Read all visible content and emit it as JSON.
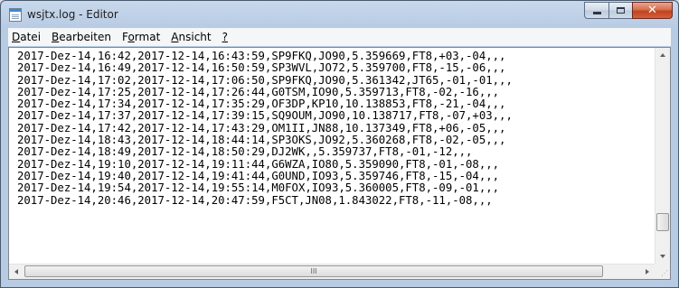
{
  "window": {
    "title": "wsjtx.log - Editor",
    "buttons": {
      "minimize": "–",
      "maximize": "□",
      "close": "✕"
    }
  },
  "menu": [
    {
      "label": "Datei",
      "mnemonic": "D",
      "rest": "atei"
    },
    {
      "label": "Bearbeiten",
      "mnemonic": "B",
      "rest": "earbeiten"
    },
    {
      "label": "Format",
      "pre": "F",
      "mnemonic": "o",
      "rest": "rmat"
    },
    {
      "label": "Ansicht",
      "mnemonic": "A",
      "rest": "nsicht"
    },
    {
      "label": "?",
      "mnemonic": "?",
      "rest": ""
    }
  ],
  "editor": {
    "lines": [
      "2017-Dez-14,16:42,2017-12-14,16:43:59,SP9FKQ,JO90,5.359669,FT8,+03,-04,,,",
      "2017-Dez-14,16:49,2017-12-14,16:50:59,SP3WVL,JO72,5.359700,FT8,-15,-06,,,",
      "2017-Dez-14,17:02,2017-12-14,17:06:50,SP9FKQ,JO90,5.361342,JT65,-01,-01,,,",
      "2017-Dez-14,17:25,2017-12-14,17:26:44,G0TSM,IO90,5.359713,FT8,-02,-16,,,",
      "2017-Dez-14,17:34,2017-12-14,17:35:29,OF3DP,KP10,10.138853,FT8,-21,-04,,,",
      "2017-Dez-14,17:37,2017-12-14,17:39:15,SQ9OUM,JO90,10.138717,FT8,-07,+03,,,",
      "2017-Dez-14,17:42,2017-12-14,17:43:29,OM1II,JN88,10.137349,FT8,+06,-05,,,",
      "2017-Dez-14,18:43,2017-12-14,18:44:14,SP3OKS,JO92,5.360268,FT8,-02,-05,,,",
      "2017-Dez-14,18:49,2017-12-14,18:50:29,DJ2WK,,5.359737,FT8,-01,-12,,,",
      "2017-Dez-14,19:10,2017-12-14,19:11:44,G6WZA,IO80,5.359090,FT8,-01,-08,,,",
      "2017-Dez-14,19:40,2017-12-14,19:41:44,G0UND,IO93,5.359746,FT8,-15,-04,,,",
      "2017-Dez-14,19:54,2017-12-14,19:55:14,M0FOX,IO93,5.360005,FT8,-09,-01,,,",
      "2017-Dez-14,20:46,2017-12-14,20:47:59,F5CT,JN08,1.843022,FT8,-11,-08,,,"
    ]
  },
  "scrollbars": {
    "vertical_position": 1.0,
    "horizontal_position": 0.0,
    "grip_glyph": "III"
  },
  "icons": {
    "window": "notepad-icon",
    "resize": "resize-grip-icon"
  }
}
